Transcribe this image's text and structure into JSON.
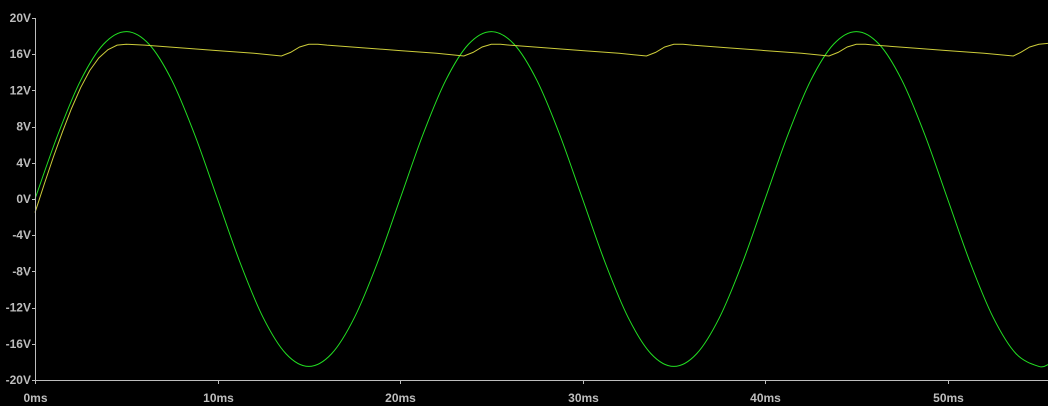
{
  "chart_data": {
    "type": "line",
    "title": "",
    "xlabel": "",
    "ylabel": "",
    "xlim": [
      0,
      55.5
    ],
    "ylim": [
      -20,
      20
    ],
    "grid": false,
    "background": "#000000",
    "axis_color": "#bdbdbd",
    "x_ticks": [
      "0ms",
      "10ms",
      "20ms",
      "30ms",
      "40ms",
      "50ms"
    ],
    "x_tick_values": [
      0,
      10,
      20,
      30,
      40,
      50
    ],
    "y_ticks": [
      "20V",
      "16V",
      "12V",
      "8V",
      "4V",
      "0V",
      "-4V",
      "-8V",
      "-12V",
      "-16V",
      "-20V"
    ],
    "y_tick_values": [
      20,
      16,
      12,
      8,
      4,
      0,
      -4,
      -8,
      -12,
      -16,
      -20
    ],
    "series": [
      {
        "color": "#22e022",
        "x": [
          0,
          1.25,
          2.5,
          3.75,
          5,
          6.25,
          7.5,
          8.75,
          10,
          11.25,
          12.5,
          13.75,
          15,
          16.25,
          17.5,
          18.75,
          20,
          21.25,
          22.5,
          23.75,
          25,
          26.25,
          27.5,
          28.75,
          30,
          31.25,
          32.5,
          33.75,
          35,
          36.25,
          37.5,
          38.75,
          40,
          41.25,
          42.5,
          43.75,
          45,
          46.25,
          47.5,
          48.75,
          50,
          51.25,
          52.5,
          53.75,
          55,
          55.5
        ],
        "values": [
          0,
          7.1,
          13.1,
          17.1,
          18.5,
          17.1,
          13.1,
          7.1,
          0,
          -7.1,
          -13.1,
          -17.1,
          -18.5,
          -17.1,
          -13.1,
          -7.1,
          0,
          7.1,
          13.1,
          17.1,
          18.5,
          17.1,
          13.1,
          7.1,
          0,
          -7.1,
          -13.1,
          -17.1,
          -18.5,
          -17.1,
          -13.1,
          -7.1,
          0,
          7.1,
          13.1,
          17.1,
          18.5,
          17.1,
          13.1,
          7.1,
          0,
          -7.1,
          -13.1,
          -17.1,
          -18.5,
          -18.3
        ]
      },
      {
        "color": "#cdcd3a",
        "x": [
          0,
          0.5,
          1,
          1.5,
          2,
          2.5,
          3,
          3.5,
          4,
          4.5,
          5,
          6,
          8,
          10,
          12,
          13.5,
          14,
          14.5,
          15,
          15.5,
          16,
          18,
          20,
          22,
          23.5,
          24,
          24.5,
          25,
          25.5,
          26,
          28,
          30,
          32,
          33.5,
          34,
          34.5,
          35,
          35.5,
          36,
          38,
          40,
          42,
          43.5,
          44,
          44.5,
          45,
          45.5,
          46,
          48,
          50,
          52,
          53.6,
          54,
          54.5,
          55,
          55.5
        ],
        "values": [
          -1.5,
          1.6,
          4.6,
          7.4,
          10,
          12.3,
          14.2,
          15.6,
          16.5,
          17,
          17.1,
          17,
          16.7,
          16.4,
          16.1,
          15.8,
          16.2,
          16.8,
          17.1,
          17.1,
          17,
          16.7,
          16.4,
          16.1,
          15.8,
          16.2,
          16.8,
          17.1,
          17.1,
          17,
          16.7,
          16.4,
          16.1,
          15.8,
          16.2,
          16.8,
          17.1,
          17.1,
          17,
          16.7,
          16.4,
          16.1,
          15.8,
          16.2,
          16.8,
          17.1,
          17.1,
          17,
          16.7,
          16.4,
          16.1,
          15.8,
          16.2,
          16.8,
          17.1,
          17.2
        ]
      }
    ]
  }
}
